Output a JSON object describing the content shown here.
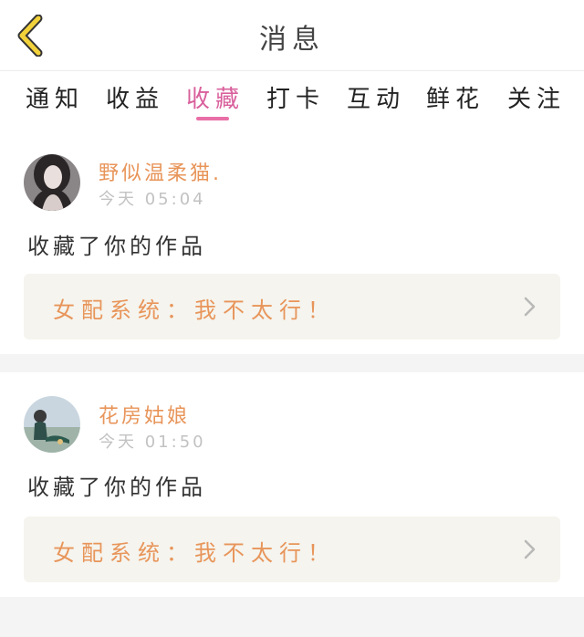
{
  "header": {
    "title": "消息",
    "back_icon": "chevron-left-icon",
    "back_color": "#f2d23a"
  },
  "tabs": [
    {
      "label": "通知"
    },
    {
      "label": "收益"
    },
    {
      "label": "收藏",
      "active": true
    },
    {
      "label": "打卡"
    },
    {
      "label": "互动"
    },
    {
      "label": "鲜花"
    },
    {
      "label": "关注"
    }
  ],
  "notifications": [
    {
      "username": "野似温柔猫.",
      "time": "今天 05:04",
      "action": "收藏了你的作品",
      "work_title": "女配系统：我不太行！"
    },
    {
      "username": "花房姑娘",
      "time": "今天 01:50",
      "action": "收藏了你的作品",
      "work_title": "女配系统：我不太行！"
    }
  ],
  "colors": {
    "accent_pink": "#d9609c",
    "username_orange": "#e8955a",
    "time_gray": "#c2c2c2",
    "work_box_bg": "#f5f4ee"
  }
}
